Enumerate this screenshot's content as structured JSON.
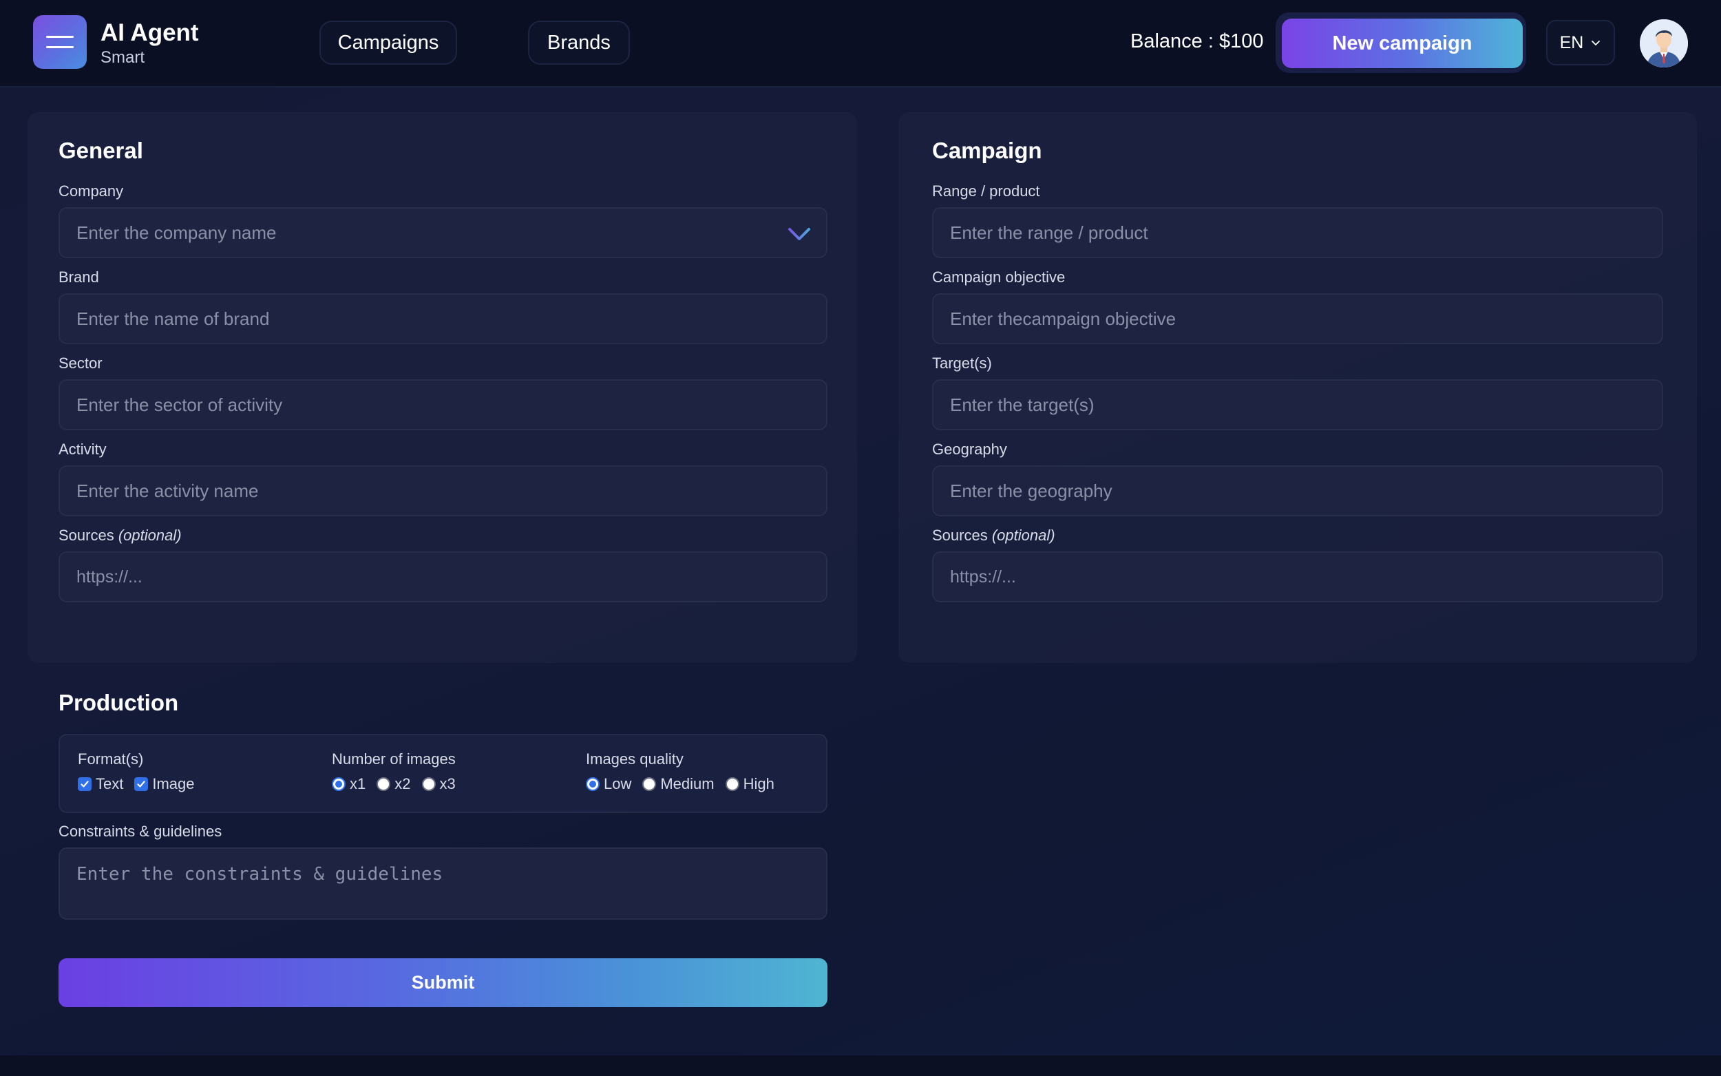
{
  "header": {
    "app_title": "AI Agent",
    "app_subtitle": "Smart",
    "nav": [
      {
        "label": "Campaigns"
      },
      {
        "label": "Brands"
      }
    ],
    "balance_label": "Balance : ",
    "balance_value": "$100",
    "new_campaign_label": "New campaign",
    "language": "EN"
  },
  "general": {
    "title": "General",
    "company": {
      "label": "Company",
      "placeholder": "Enter the company name"
    },
    "brand": {
      "label": "Brand",
      "placeholder": "Enter the name of brand"
    },
    "sector": {
      "label": "Sector",
      "placeholder": "Enter the sector of activity"
    },
    "activity": {
      "label": "Activity",
      "placeholder": "Enter the activity name"
    },
    "sources": {
      "label": "Sources",
      "optional": "(optional)",
      "placeholder": "https://..."
    }
  },
  "campaign": {
    "title": "Campaign",
    "range": {
      "label": "Range / product",
      "placeholder": "Enter the range / product"
    },
    "objective": {
      "label": "Campaign objective",
      "placeholder": "Enter thecampaign objective"
    },
    "targets": {
      "label": "Target(s)",
      "placeholder": "Enter the target(s)"
    },
    "geography": {
      "label": "Geography",
      "placeholder": "Enter the geography"
    },
    "sources": {
      "label": "Sources",
      "optional": "(optional)",
      "placeholder": "https://..."
    }
  },
  "production": {
    "title": "Production",
    "formats": {
      "label": "Format(s)",
      "options": [
        "Text",
        "Image"
      ],
      "checked": [
        "Text",
        "Image"
      ]
    },
    "number_of_images": {
      "label": "Number of images",
      "options": [
        "x1",
        "x2",
        "x3"
      ],
      "selected": "x1"
    },
    "images_quality": {
      "label": "Images quality",
      "options": [
        "Low",
        "Medium",
        "High"
      ],
      "selected": "Low"
    },
    "constraints": {
      "label": "Constraints & guidelines",
      "placeholder": "Enter the constraints & guidelines"
    },
    "submit_label": "Submit"
  },
  "colors": {
    "accent_purple": "#7a44e6",
    "accent_cyan": "#4fb4d8",
    "checkbox_blue": "#2f6fe8"
  },
  "icons": [
    "menu-icon",
    "chevron-down-icon",
    "avatar-icon"
  ]
}
